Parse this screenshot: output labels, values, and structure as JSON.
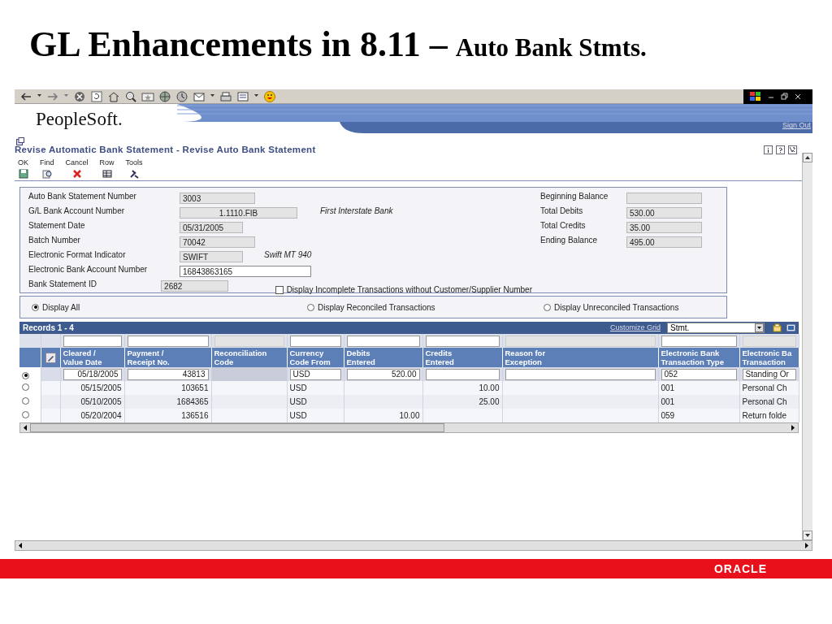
{
  "slide_title": {
    "main": "GL Enhancements in 8.11 –",
    "sub": "Auto Bank Stmts."
  },
  "header": {
    "logo": "PeopleSoft.",
    "sign_out": "Sign Out"
  },
  "form_title": "Revise Automatic Bank Statement - Revise Auto Bank Statement",
  "toolbar": [
    {
      "label": "OK",
      "kind": "save"
    },
    {
      "label": "Find",
      "kind": "find"
    },
    {
      "label": "Cancel",
      "kind": "cancel"
    },
    {
      "label": "Row",
      "kind": "row"
    },
    {
      "label": "Tools",
      "kind": "tools"
    }
  ],
  "fields_left": [
    {
      "label": "Auto Bank Statement Number",
      "value": "3003",
      "editable": false
    },
    {
      "label": "G/L Bank Account Number",
      "value": "1.1110.FIB",
      "editable": false,
      "note": "First Interstate Bank"
    },
    {
      "label": "Statement Date",
      "value": "05/31/2005",
      "editable": false
    },
    {
      "label": "Batch Number",
      "value": "70042",
      "editable": false
    },
    {
      "label": "Electronic Format Indicator",
      "value": "SWIFT",
      "editable": false,
      "note": "Swift MT 940"
    },
    {
      "label": "Electronic Bank Account Number",
      "value": "16843863165",
      "editable": true
    },
    {
      "label": "Bank Statement ID",
      "value": "2682",
      "editable": false
    }
  ],
  "fields_right": [
    {
      "label": "Beginning Balance",
      "editable": false
    },
    {
      "label": "Total Debits",
      "value": "530.00",
      "editable": false
    },
    {
      "label": "Total Credits",
      "value": "35.00",
      "editable": false
    },
    {
      "label": "Ending Balance",
      "value": "495.00",
      "editable": false
    }
  ],
  "checkbox": {
    "label": "Display Incomplete Transactions without Customer/Supplier Number",
    "checked": false
  },
  "radios": [
    {
      "label": "Display All",
      "selected": true
    },
    {
      "label": "Display Reconciled Transactions",
      "selected": false
    },
    {
      "label": "Display Unreconciled Transactions",
      "selected": false
    }
  ],
  "grid": {
    "records": "Records 1 - 4",
    "customize": "Customize Grid",
    "format": "Stmt.",
    "columns": [
      {
        "kind": "select"
      },
      {
        "kind": "icon"
      },
      {
        "kind": "data",
        "lines": [
          "Cleared /",
          "Value Date"
        ],
        "filter_enabled": true,
        "editable": true
      },
      {
        "kind": "data",
        "lines": [
          "Payment /",
          "Receipt No."
        ],
        "filter_enabled": true,
        "editable": true
      },
      {
        "kind": "data",
        "lines": [
          "Reconciliation",
          "Code"
        ],
        "filter_enabled": false,
        "editable": false
      },
      {
        "kind": "data",
        "lines": [
          "Currency",
          "Code From"
        ],
        "filter_enabled": true,
        "editable": true
      },
      {
        "kind": "data",
        "lines": [
          "Debits",
          "Entered"
        ],
        "filter_enabled": true,
        "editable": true
      },
      {
        "kind": "data",
        "lines": [
          "Credits",
          "Entered"
        ],
        "filter_enabled": true,
        "editable": true
      },
      {
        "kind": "data",
        "lines": [
          "Reason for",
          "Exception"
        ],
        "filter_enabled": false,
        "editable": true
      },
      {
        "kind": "data",
        "lines": [
          "Electronic Bank",
          "Transaction Type"
        ],
        "filter_enabled": true,
        "editable": true
      },
      {
        "kind": "data",
        "lines": [
          "Electronic Ba",
          "Transaction"
        ],
        "filter_enabled": false,
        "editable": true
      }
    ],
    "rows": [
      {
        "selected": true,
        "cells": [
          null,
          null,
          "05/18/2005",
          "43813",
          null,
          "USD",
          "520.00",
          null,
          null,
          "052",
          "Standing Or"
        ]
      },
      {
        "selected": false,
        "cells": [
          null,
          null,
          "05/15/2005",
          "103651",
          null,
          "USD",
          null,
          "10.00",
          null,
          "001",
          "Personal Ch"
        ]
      },
      {
        "selected": false,
        "cells": [
          null,
          null,
          "05/10/2005",
          "1684365",
          null,
          "USD",
          null,
          "25.00",
          null,
          "001",
          "Personal Ch"
        ]
      },
      {
        "selected": false,
        "cells": [
          null,
          null,
          "05/20/2004",
          "136516",
          null,
          "USD",
          "10.00",
          null,
          null,
          "059",
          "Return folde"
        ]
      }
    ]
  },
  "footer": {
    "logo": "ORACLE"
  }
}
